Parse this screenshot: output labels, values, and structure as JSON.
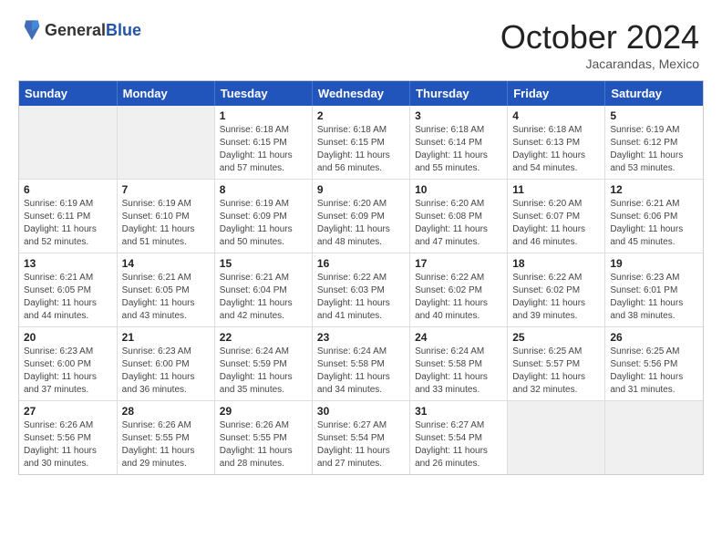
{
  "header": {
    "logo_general": "General",
    "logo_blue": "Blue",
    "month_title": "October 2024",
    "location": "Jacarandas, Mexico"
  },
  "days_of_week": [
    "Sunday",
    "Monday",
    "Tuesday",
    "Wednesday",
    "Thursday",
    "Friday",
    "Saturday"
  ],
  "weeks": [
    [
      {
        "day": "",
        "info": ""
      },
      {
        "day": "",
        "info": ""
      },
      {
        "day": "1",
        "info": "Sunrise: 6:18 AM\nSunset: 6:15 PM\nDaylight: 11 hours and 57 minutes."
      },
      {
        "day": "2",
        "info": "Sunrise: 6:18 AM\nSunset: 6:15 PM\nDaylight: 11 hours and 56 minutes."
      },
      {
        "day": "3",
        "info": "Sunrise: 6:18 AM\nSunset: 6:14 PM\nDaylight: 11 hours and 55 minutes."
      },
      {
        "day": "4",
        "info": "Sunrise: 6:18 AM\nSunset: 6:13 PM\nDaylight: 11 hours and 54 minutes."
      },
      {
        "day": "5",
        "info": "Sunrise: 6:19 AM\nSunset: 6:12 PM\nDaylight: 11 hours and 53 minutes."
      }
    ],
    [
      {
        "day": "6",
        "info": "Sunrise: 6:19 AM\nSunset: 6:11 PM\nDaylight: 11 hours and 52 minutes."
      },
      {
        "day": "7",
        "info": "Sunrise: 6:19 AM\nSunset: 6:10 PM\nDaylight: 11 hours and 51 minutes."
      },
      {
        "day": "8",
        "info": "Sunrise: 6:19 AM\nSunset: 6:09 PM\nDaylight: 11 hours and 50 minutes."
      },
      {
        "day": "9",
        "info": "Sunrise: 6:20 AM\nSunset: 6:09 PM\nDaylight: 11 hours and 48 minutes."
      },
      {
        "day": "10",
        "info": "Sunrise: 6:20 AM\nSunset: 6:08 PM\nDaylight: 11 hours and 47 minutes."
      },
      {
        "day": "11",
        "info": "Sunrise: 6:20 AM\nSunset: 6:07 PM\nDaylight: 11 hours and 46 minutes."
      },
      {
        "day": "12",
        "info": "Sunrise: 6:21 AM\nSunset: 6:06 PM\nDaylight: 11 hours and 45 minutes."
      }
    ],
    [
      {
        "day": "13",
        "info": "Sunrise: 6:21 AM\nSunset: 6:05 PM\nDaylight: 11 hours and 44 minutes."
      },
      {
        "day": "14",
        "info": "Sunrise: 6:21 AM\nSunset: 6:05 PM\nDaylight: 11 hours and 43 minutes."
      },
      {
        "day": "15",
        "info": "Sunrise: 6:21 AM\nSunset: 6:04 PM\nDaylight: 11 hours and 42 minutes."
      },
      {
        "day": "16",
        "info": "Sunrise: 6:22 AM\nSunset: 6:03 PM\nDaylight: 11 hours and 41 minutes."
      },
      {
        "day": "17",
        "info": "Sunrise: 6:22 AM\nSunset: 6:02 PM\nDaylight: 11 hours and 40 minutes."
      },
      {
        "day": "18",
        "info": "Sunrise: 6:22 AM\nSunset: 6:02 PM\nDaylight: 11 hours and 39 minutes."
      },
      {
        "day": "19",
        "info": "Sunrise: 6:23 AM\nSunset: 6:01 PM\nDaylight: 11 hours and 38 minutes."
      }
    ],
    [
      {
        "day": "20",
        "info": "Sunrise: 6:23 AM\nSunset: 6:00 PM\nDaylight: 11 hours and 37 minutes."
      },
      {
        "day": "21",
        "info": "Sunrise: 6:23 AM\nSunset: 6:00 PM\nDaylight: 11 hours and 36 minutes."
      },
      {
        "day": "22",
        "info": "Sunrise: 6:24 AM\nSunset: 5:59 PM\nDaylight: 11 hours and 35 minutes."
      },
      {
        "day": "23",
        "info": "Sunrise: 6:24 AM\nSunset: 5:58 PM\nDaylight: 11 hours and 34 minutes."
      },
      {
        "day": "24",
        "info": "Sunrise: 6:24 AM\nSunset: 5:58 PM\nDaylight: 11 hours and 33 minutes."
      },
      {
        "day": "25",
        "info": "Sunrise: 6:25 AM\nSunset: 5:57 PM\nDaylight: 11 hours and 32 minutes."
      },
      {
        "day": "26",
        "info": "Sunrise: 6:25 AM\nSunset: 5:56 PM\nDaylight: 11 hours and 31 minutes."
      }
    ],
    [
      {
        "day": "27",
        "info": "Sunrise: 6:26 AM\nSunset: 5:56 PM\nDaylight: 11 hours and 30 minutes."
      },
      {
        "day": "28",
        "info": "Sunrise: 6:26 AM\nSunset: 5:55 PM\nDaylight: 11 hours and 29 minutes."
      },
      {
        "day": "29",
        "info": "Sunrise: 6:26 AM\nSunset: 5:55 PM\nDaylight: 11 hours and 28 minutes."
      },
      {
        "day": "30",
        "info": "Sunrise: 6:27 AM\nSunset: 5:54 PM\nDaylight: 11 hours and 27 minutes."
      },
      {
        "day": "31",
        "info": "Sunrise: 6:27 AM\nSunset: 5:54 PM\nDaylight: 11 hours and 26 minutes."
      },
      {
        "day": "",
        "info": ""
      },
      {
        "day": "",
        "info": ""
      }
    ]
  ]
}
